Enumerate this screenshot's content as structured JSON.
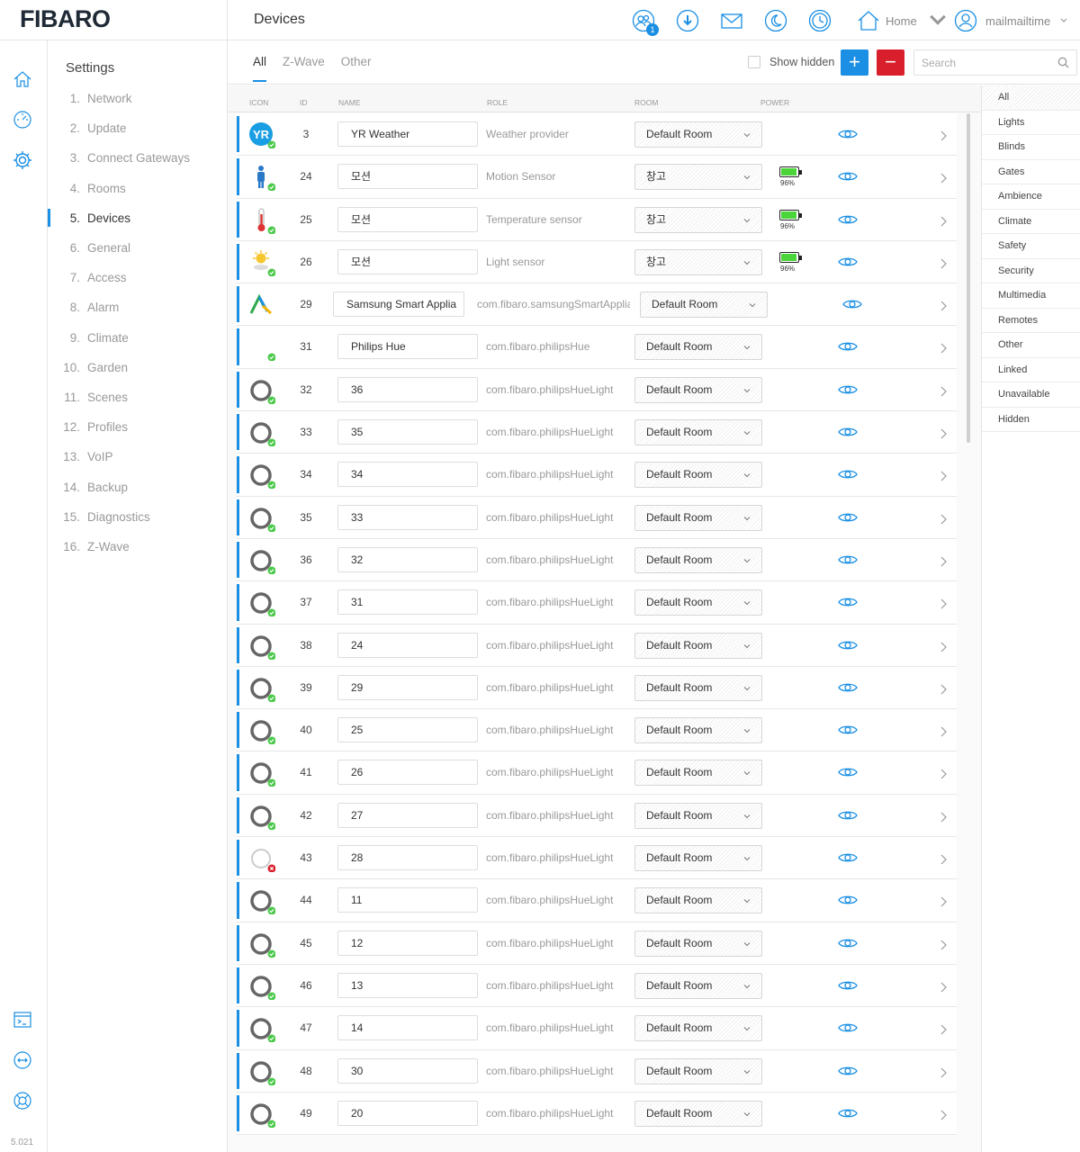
{
  "app": {
    "logo": "FIBARO",
    "page_title": "Devices",
    "version": "5.021"
  },
  "topbar": {
    "notifications_badge": "1",
    "home_label": "Home",
    "user_label": "mailmailtime",
    "icons": [
      "users-icon",
      "download-icon",
      "mail-icon",
      "moon-icon",
      "clock-icon",
      "home-icon",
      "user-icon"
    ]
  },
  "settings": {
    "title": "Settings",
    "items": [
      {
        "num": "1.",
        "label": "Network"
      },
      {
        "num": "2.",
        "label": "Update"
      },
      {
        "num": "3.",
        "label": "Connect Gateways"
      },
      {
        "num": "4.",
        "label": "Rooms"
      },
      {
        "num": "5.",
        "label": "Devices"
      },
      {
        "num": "6.",
        "label": "General"
      },
      {
        "num": "7.",
        "label": "Access"
      },
      {
        "num": "8.",
        "label": "Alarm"
      },
      {
        "num": "9.",
        "label": "Climate"
      },
      {
        "num": "10.",
        "label": "Garden"
      },
      {
        "num": "11.",
        "label": "Scenes"
      },
      {
        "num": "12.",
        "label": "Profiles"
      },
      {
        "num": "13.",
        "label": "VoIP"
      },
      {
        "num": "14.",
        "label": "Backup"
      },
      {
        "num": "15.",
        "label": "Diagnostics"
      },
      {
        "num": "16.",
        "label": "Z-Wave"
      }
    ],
    "active_index": 4
  },
  "tabs": [
    {
      "label": "All",
      "active": true
    },
    {
      "label": "Z-Wave",
      "active": false
    },
    {
      "label": "Other",
      "active": false
    }
  ],
  "toolbar": {
    "show_hidden_label": "Show hidden",
    "add_label": "+",
    "remove_label": "−",
    "search_placeholder": "Search"
  },
  "table": {
    "headers": {
      "icon": "ICON",
      "id": "ID",
      "name": "NAME",
      "role": "ROLE",
      "room": "ROOM",
      "power": "POWER"
    },
    "rows": [
      {
        "icon": "yr",
        "id": "3",
        "name": "YR Weather",
        "role": "Weather provider",
        "room": "Default Room",
        "battery": null,
        "status": "ok"
      },
      {
        "icon": "motion",
        "id": "24",
        "name": "모션",
        "role": "Motion Sensor",
        "room": "창고",
        "battery": "96%",
        "status": "ok"
      },
      {
        "icon": "temp",
        "id": "25",
        "name": "모션",
        "role": "Temperature sensor",
        "room": "창고",
        "battery": "96%",
        "status": "ok"
      },
      {
        "icon": "light",
        "id": "26",
        "name": "모션",
        "role": "Light sensor",
        "room": "창고",
        "battery": "96%",
        "status": "ok"
      },
      {
        "icon": "samsung",
        "id": "29",
        "name": "Samsung Smart Applia",
        "role": "com.fibaro.samsungSmartApplian",
        "room": "Default Room",
        "battery": null,
        "status": "none"
      },
      {
        "icon": "blank",
        "id": "31",
        "name": "Philips Hue",
        "role": "com.fibaro.philipsHue",
        "room": "Default Room",
        "battery": null,
        "status": "ok"
      },
      {
        "icon": "ring",
        "id": "32",
        "name": "36",
        "role": "com.fibaro.philipsHueLight",
        "room": "Default Room",
        "battery": null,
        "status": "ok"
      },
      {
        "icon": "ring",
        "id": "33",
        "name": "35",
        "role": "com.fibaro.philipsHueLight",
        "room": "Default Room",
        "battery": null,
        "status": "ok"
      },
      {
        "icon": "ring",
        "id": "34",
        "name": "34",
        "role": "com.fibaro.philipsHueLight",
        "room": "Default Room",
        "battery": null,
        "status": "ok"
      },
      {
        "icon": "ring",
        "id": "35",
        "name": "33",
        "role": "com.fibaro.philipsHueLight",
        "room": "Default Room",
        "battery": null,
        "status": "ok"
      },
      {
        "icon": "ring",
        "id": "36",
        "name": "32",
        "role": "com.fibaro.philipsHueLight",
        "room": "Default Room",
        "battery": null,
        "status": "ok"
      },
      {
        "icon": "ring",
        "id": "37",
        "name": "31",
        "role": "com.fibaro.philipsHueLight",
        "room": "Default Room",
        "battery": null,
        "status": "ok"
      },
      {
        "icon": "ring",
        "id": "38",
        "name": "24",
        "role": "com.fibaro.philipsHueLight",
        "room": "Default Room",
        "battery": null,
        "status": "ok"
      },
      {
        "icon": "ring",
        "id": "39",
        "name": "29",
        "role": "com.fibaro.philipsHueLight",
        "room": "Default Room",
        "battery": null,
        "status": "ok"
      },
      {
        "icon": "ring",
        "id": "40",
        "name": "25",
        "role": "com.fibaro.philipsHueLight",
        "room": "Default Room",
        "battery": null,
        "status": "ok"
      },
      {
        "icon": "ring",
        "id": "41",
        "name": "26",
        "role": "com.fibaro.philipsHueLight",
        "room": "Default Room",
        "battery": null,
        "status": "ok"
      },
      {
        "icon": "ring",
        "id": "42",
        "name": "27",
        "role": "com.fibaro.philipsHueLight",
        "room": "Default Room",
        "battery": null,
        "status": "ok"
      },
      {
        "icon": "ring-light",
        "id": "43",
        "name": "28",
        "role": "com.fibaro.philipsHueLight",
        "room": "Default Room",
        "battery": null,
        "status": "error"
      },
      {
        "icon": "ring",
        "id": "44",
        "name": "11",
        "role": "com.fibaro.philipsHueLight",
        "room": "Default Room",
        "battery": null,
        "status": "ok"
      },
      {
        "icon": "ring",
        "id": "45",
        "name": "12",
        "role": "com.fibaro.philipsHueLight",
        "room": "Default Room",
        "battery": null,
        "status": "ok"
      },
      {
        "icon": "ring",
        "id": "46",
        "name": "13",
        "role": "com.fibaro.philipsHueLight",
        "room": "Default Room",
        "battery": null,
        "status": "ok"
      },
      {
        "icon": "ring",
        "id": "47",
        "name": "14",
        "role": "com.fibaro.philipsHueLight",
        "room": "Default Room",
        "battery": null,
        "status": "ok"
      },
      {
        "icon": "ring",
        "id": "48",
        "name": "30",
        "role": "com.fibaro.philipsHueLight",
        "room": "Default Room",
        "battery": null,
        "status": "ok"
      },
      {
        "icon": "ring",
        "id": "49",
        "name": "20",
        "role": "com.fibaro.philipsHueLight",
        "room": "Default Room",
        "battery": null,
        "status": "ok"
      }
    ]
  },
  "categories": {
    "items": [
      "All",
      "Lights",
      "Blinds",
      "Gates",
      "Ambience",
      "Climate",
      "Safety",
      "Security",
      "Multimedia",
      "Remotes",
      "Other",
      "Linked",
      "Unavailable",
      "Hidden"
    ],
    "active_index": 0
  },
  "colors": {
    "accent": "#1a8fe3",
    "danger": "#d81f2b",
    "ok": "#4bc94a",
    "battery": "#4bd53a"
  }
}
